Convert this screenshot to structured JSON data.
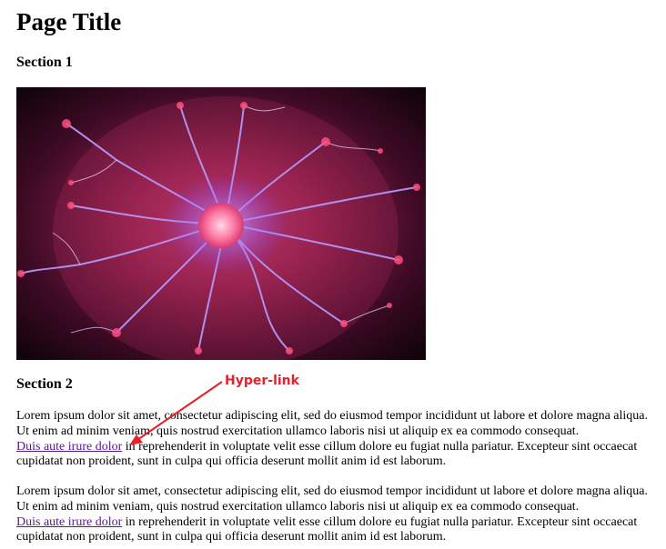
{
  "page": {
    "title": "Page Title",
    "section1_heading": "Section 1",
    "section2_heading": "Section 2"
  },
  "image": {
    "subject": "plasma-ball-photo"
  },
  "annotation": {
    "label": "Hyper-link",
    "color": "#e8202a"
  },
  "paragraphs": [
    {
      "text_before": "Lorem ipsum dolor sit amet, consectetur adipiscing elit, sed do eiusmod tempor incididunt ut labore et dolore magna aliqua. Ut enim ad minim veniam, quis nostrud exercitation ullamco laboris nisi ut aliquip ex ea commodo consequat.",
      "link_text": "Duis aute irure dolor",
      "text_after": " in reprehenderit in voluptate velit esse cillum dolore eu fugiat nulla pariatur. Excepteur sint occaecat cupidatat non proident, sunt in culpa qui officia deserunt mollit anim id est laborum."
    },
    {
      "text_before": "Lorem ipsum dolor sit amet, consectetur adipiscing elit, sed do eiusmod tempor incididunt ut labore et dolore magna aliqua. Ut enim ad minim veniam, quis nostrud exercitation ullamco laboris nisi ut aliquip ex ea commodo consequat.",
      "link_text": "Duis aute irure dolor",
      "text_after": " in reprehenderit in voluptate velit esse cillum dolore eu fugiat nulla pariatur. Excepteur sint occaecat cupidatat non proident, sunt in culpa qui officia deserunt mollit anim id est laborum."
    }
  ],
  "colors": {
    "link_visited": "#551a8b",
    "annotation_red": "#e8202a"
  }
}
